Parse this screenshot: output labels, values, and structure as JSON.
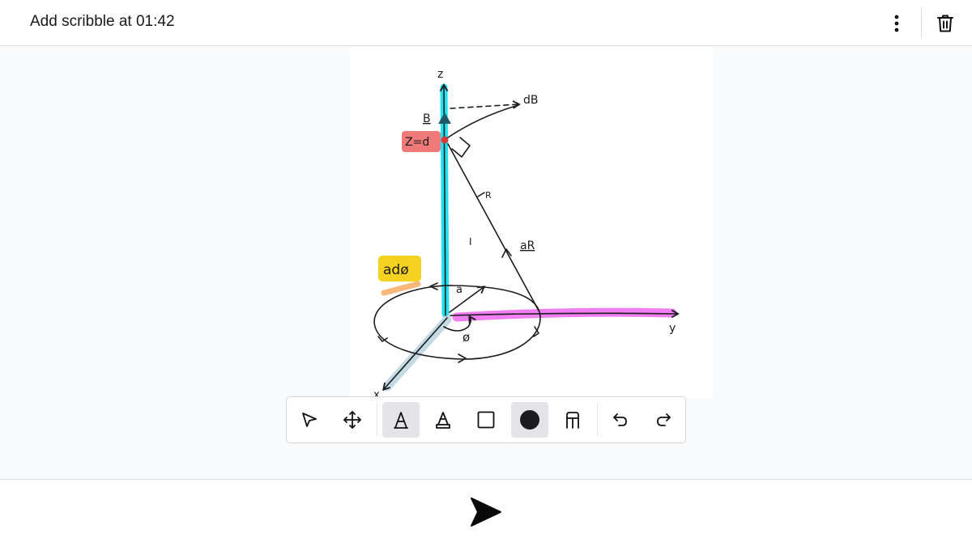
{
  "header": {
    "title": "Add scribble at 01:42",
    "menu_icon": "more-vertical-icon",
    "delete_icon": "trash-icon"
  },
  "drawing": {
    "labels": {
      "z": "z",
      "dB": "dB",
      "B": "B",
      "z_eq_d": "Z=d",
      "R": "R",
      "I": "I",
      "aR": "aR",
      "a_dphi": "adø",
      "a": "a",
      "phi": "ø",
      "y": "y",
      "x": "x"
    },
    "colors": {
      "z_axis_highlight": "#20e0f2",
      "y_axis_highlight": "#f27ef4",
      "x_axis_highlight": "#bcd6e2",
      "z_label_highlight": "#ee6b6b",
      "adphi_highlight": "#f5d21f",
      "adphi_underline": "#f8b87a",
      "point": "#d83a3a",
      "ink": "#1c1c1c"
    }
  },
  "toolbar": {
    "tools": [
      {
        "name": "select",
        "icon": "pointer-icon",
        "active": false
      },
      {
        "name": "pan",
        "icon": "move-icon",
        "active": false
      },
      {
        "name": "pen",
        "icon": "pen-tool-icon",
        "active": true
      },
      {
        "name": "highlighter",
        "icon": "highlighter-tool-icon",
        "active": false
      },
      {
        "name": "rectangle",
        "icon": "square-icon",
        "active": false
      },
      {
        "name": "color",
        "icon": "color-swatch-icon",
        "active": true,
        "value": "#1c1c20"
      },
      {
        "name": "eraser",
        "icon": "eraser-icon",
        "active": false
      },
      {
        "name": "undo",
        "icon": "undo-icon",
        "active": false
      },
      {
        "name": "redo",
        "icon": "redo-icon",
        "active": false
      }
    ]
  },
  "footer": {
    "send_icon": "send-icon"
  }
}
